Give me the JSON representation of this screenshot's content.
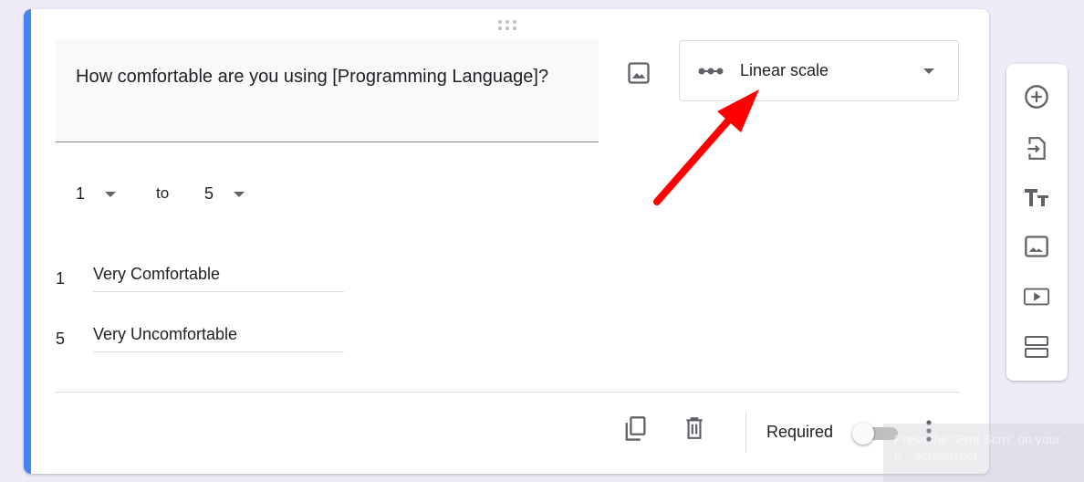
{
  "question": {
    "title": "How comfortable are you using [Programming Language]?",
    "type": "Linear scale",
    "type_icon": "linear-scale-icon"
  },
  "scale": {
    "from": "1",
    "to_label": "to",
    "to": "5"
  },
  "labels": [
    {
      "n": "1",
      "text": "Very Comfortable"
    },
    {
      "n": "5",
      "text": "Very Uncomfortable"
    }
  ],
  "footer": {
    "required_label": "Required",
    "required": false
  },
  "sidebar": [
    "add-question",
    "import-questions",
    "add-title",
    "add-image",
    "add-video",
    "add-section"
  ],
  "toast": "Press the \"Prnt Scrn\" on your k... screenshot",
  "annotation": {
    "arrow_color": "#ff0000"
  },
  "colors": {
    "accent": "#4285f4",
    "background": "#f0ebf8"
  }
}
